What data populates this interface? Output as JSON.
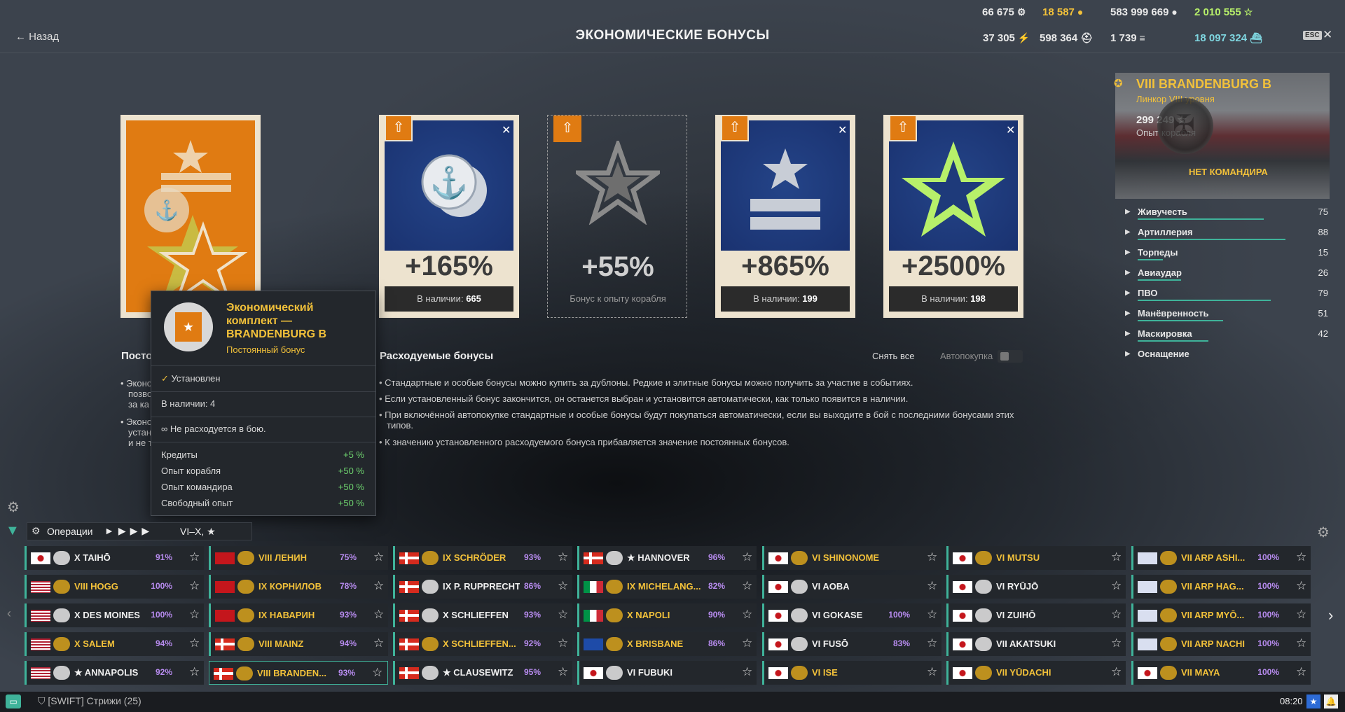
{
  "header": {
    "back_label": "Назад",
    "title": "ЭКОНОМИЧЕСКИЕ БОНУСЫ",
    "esc_label": "ESC",
    "currencies_row1": [
      "66 675",
      "18 587",
      "583 999 669",
      "2 010 555"
    ],
    "currencies_row2": [
      "37 305",
      "598 364",
      "1 739",
      "18 097 324"
    ]
  },
  "cards": [
    {
      "pct": "+165%",
      "stock_label": "В наличии:",
      "stock": "665",
      "color": "#1e3a7a"
    },
    {
      "pct": "+55%",
      "sub": "Бонус к опыту корабля"
    },
    {
      "pct": "+865%",
      "stock_label": "В наличии:",
      "stock": "199"
    },
    {
      "pct": "+2500%",
      "stock_label": "В наличии:",
      "stock": "198"
    }
  ],
  "permanent": {
    "heading": "Посто",
    "bullets": [
      "Эконо",
      "позво",
      "за ка",
      "Эконо",
      "устан",
      "и не т"
    ]
  },
  "consumable": {
    "heading": "Расходуемые бонусы",
    "remove_all": "Снять все",
    "autobuy": "Автопокупка",
    "bullets": [
      "Стандартные и особые бонусы можно купить за дублоны. Редкие и элитные бонусы можно получить за участие в событиях.",
      "Если установленный бонус закончится, он останется выбран и установится автоматически, как только появится в наличии.",
      "При включённой автопокупке стандартные и особые бонусы будут покупаться автоматически, если вы выходите в бой с последними бонусами этих типов.",
      "К значению установленного расходуемого бонуса прибавляется значение постоянных бонусов."
    ]
  },
  "tooltip": {
    "title_l1": "Экономический",
    "title_l2": "комплект —",
    "title_l3": "BRANDENBURG B",
    "subtitle": "Постоянный бонус",
    "installed": "Установлен",
    "stock": "В наличии:  4",
    "not_consumed": "Не расходуется в бою.",
    "rows": [
      {
        "label": "Кредиты",
        "value": "+5 %"
      },
      {
        "label": "Опыт корабля",
        "value": "+50 %"
      },
      {
        "label": "Опыт командира",
        "value": "+50 %"
      },
      {
        "label": "Свободный опыт",
        "value": "+50 %"
      }
    ]
  },
  "ship": {
    "name": "VIII BRANDENBURG B",
    "type": "Линкор VIII уровня",
    "xp": "299 249",
    "xp_label": "Опыт корабля",
    "commander": "НЕТ КОМАНДИРА",
    "stats": [
      {
        "label": "Живучесть",
        "value": "75",
        "fill": 0.75
      },
      {
        "label": "Артиллерия",
        "value": "88",
        "fill": 0.88
      },
      {
        "label": "Торпеды",
        "value": "15",
        "fill": 0.15
      },
      {
        "label": "Авиаудар",
        "value": "26",
        "fill": 0.26
      },
      {
        "label": "ПВО",
        "value": "79",
        "fill": 0.79
      },
      {
        "label": "Манёвренность",
        "value": "51",
        "fill": 0.51
      },
      {
        "label": "Маскировка",
        "value": "42",
        "fill": 0.42
      },
      {
        "label": "Оснащение",
        "value": "",
        "fill": 0
      }
    ]
  },
  "filter": {
    "mode": "Операции",
    "tiers": "VI–X, ★"
  },
  "carousel": [
    [
      {
        "flag": "jp",
        "name": "X TAIHŌ",
        "pct": "91%",
        "gold": false
      },
      {
        "flag": "us",
        "name": "VIII HOGG",
        "pct": "100%",
        "gold": true
      },
      {
        "flag": "us",
        "name": "X DES MOINES",
        "pct": "100%",
        "gold": false
      },
      {
        "flag": "us",
        "name": "X SALEM",
        "pct": "94%",
        "gold": true
      },
      {
        "flag": "us",
        "name": "★ ANNAPOLIS",
        "pct": "92%",
        "gold": false
      }
    ],
    [
      {
        "flag": "su",
        "name": "VIII ЛЕНИН",
        "pct": "75%",
        "gold": true
      },
      {
        "flag": "su",
        "name": "IX КОРНИЛОВ",
        "pct": "78%",
        "gold": true
      },
      {
        "flag": "su",
        "name": "IX НАВАРИН",
        "pct": "93%",
        "gold": true
      },
      {
        "flag": "de",
        "name": "VIII MAINZ",
        "pct": "94%",
        "gold": true
      },
      {
        "flag": "de",
        "name": "VIII BRANDEN...",
        "pct": "93%",
        "gold": true
      }
    ],
    [
      {
        "flag": "de",
        "name": "IX SCHRÖDER",
        "pct": "93%",
        "gold": true
      },
      {
        "flag": "de",
        "name": "IX P. RUPPRECHT",
        "pct": "86%",
        "gold": false
      },
      {
        "flag": "de",
        "name": "X SCHLIEFFEN",
        "pct": "93%",
        "gold": false
      },
      {
        "flag": "de",
        "name": "X SCHLIEFFEN...",
        "pct": "92%",
        "gold": true
      },
      {
        "flag": "de",
        "name": "★ CLAUSEWITZ",
        "pct": "95%",
        "gold": false
      }
    ],
    [
      {
        "flag": "de",
        "name": "★ HANNOVER",
        "pct": "96%",
        "gold": false
      },
      {
        "flag": "it",
        "name": "IX MICHELANG...",
        "pct": "82%",
        "gold": true
      },
      {
        "flag": "it",
        "name": "X NAPOLI",
        "pct": "90%",
        "gold": true
      },
      {
        "flag": "eu",
        "name": "X BRISBANE",
        "pct": "86%",
        "gold": true
      },
      {
        "flag": "jp",
        "name": "VI FUBUKI",
        "pct": "",
        "gold": false
      }
    ],
    [
      {
        "flag": "jp",
        "name": "VI SHINONOME",
        "pct": "",
        "gold": true
      },
      {
        "flag": "jp",
        "name": "VI AOBA",
        "pct": "",
        "gold": false
      },
      {
        "flag": "jp",
        "name": "VI GOKASE",
        "pct": "100%",
        "gold": false
      },
      {
        "flag": "jp",
        "name": "VI FUSŌ",
        "pct": "83%",
        "gold": false
      },
      {
        "flag": "jp",
        "name": "VI ISE",
        "pct": "",
        "gold": true
      }
    ],
    [
      {
        "flag": "jp",
        "name": "VI MUTSU",
        "pct": "",
        "gold": true
      },
      {
        "flag": "jp",
        "name": "VI RYŪJŌ",
        "pct": "",
        "gold": false
      },
      {
        "flag": "jp",
        "name": "VI ZUIHŌ",
        "pct": "",
        "gold": false
      },
      {
        "flag": "jp",
        "name": "VII AKATSUKI",
        "pct": "",
        "gold": false
      },
      {
        "flag": "jp",
        "name": "VII YŪDACHI",
        "pct": "",
        "gold": true
      }
    ],
    [
      {
        "flag": "arp",
        "name": "VII ARP ASHI...",
        "pct": "100%",
        "gold": true
      },
      {
        "flag": "arp",
        "name": "VII ARP HAG...",
        "pct": "100%",
        "gold": true
      },
      {
        "flag": "arp",
        "name": "VII ARP MYŌ...",
        "pct": "100%",
        "gold": true
      },
      {
        "flag": "arp",
        "name": "VII ARP NACHI",
        "pct": "100%",
        "gold": true
      },
      {
        "flag": "jp",
        "name": "VII MAYA",
        "pct": "100%",
        "gold": true
      }
    ]
  ],
  "status": {
    "clan": "[SWIFT] Стрижи (25)",
    "time": "08:20"
  }
}
